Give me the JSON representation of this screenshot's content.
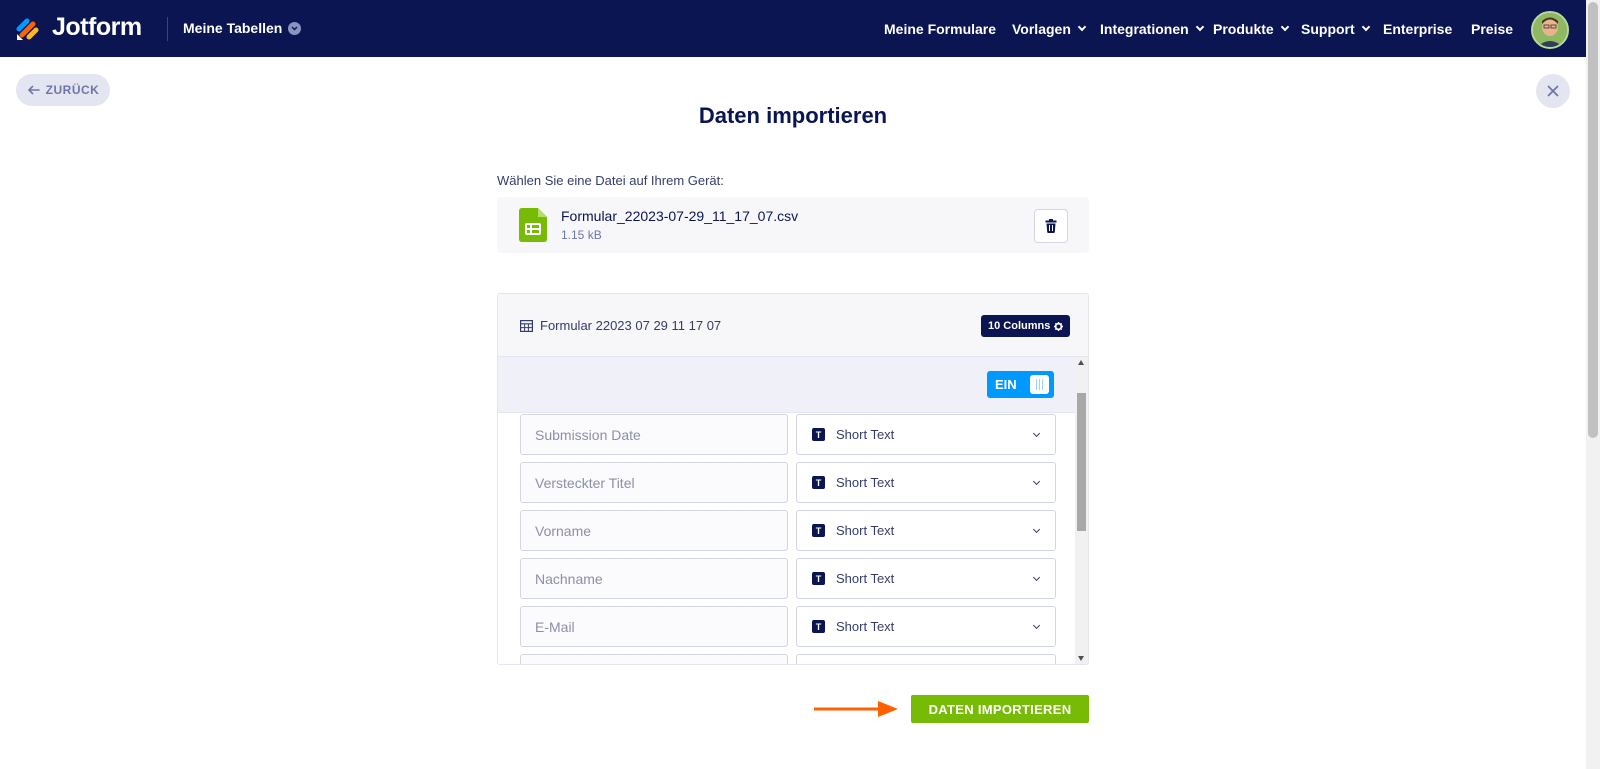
{
  "navbar": {
    "brand": "Jotform",
    "workspace": "Meine Tabellen",
    "links": [
      {
        "label": "Meine Formulare",
        "dropdown": false
      },
      {
        "label": "Vorlagen",
        "dropdown": true
      },
      {
        "label": "Integrationen",
        "dropdown": true
      },
      {
        "label": "Produkte",
        "dropdown": true
      },
      {
        "label": "Support",
        "dropdown": true
      },
      {
        "label": "Enterprise",
        "dropdown": false
      },
      {
        "label": "Preise",
        "dropdown": false
      }
    ]
  },
  "page": {
    "back_label": "ZURÜCK",
    "title": "Daten importieren",
    "choose_label": "Wählen Sie eine Datei auf Ihrem Gerät:"
  },
  "file": {
    "name": "Formular_22023-07-29_11_17_07.csv",
    "size": "1.15 kB"
  },
  "table": {
    "title": "Formular 22023 07 29 11 17 07",
    "columns_badge": "10 Columns",
    "toggle_label": "EIN",
    "rows": [
      {
        "name": "Submission Date",
        "type": "Short Text"
      },
      {
        "name": "Versteckter Titel",
        "type": "Short Text"
      },
      {
        "name": "Vorname",
        "type": "Short Text"
      },
      {
        "name": "Nachname",
        "type": "Short Text"
      },
      {
        "name": "E-Mail",
        "type": "Short Text"
      }
    ]
  },
  "actions": {
    "import_label": "DATEN IMPORTIEREN"
  },
  "colors": {
    "nav_bg": "#0a1551",
    "accent_green": "#78bb07",
    "toggle_blue": "#0099ff",
    "arrow_orange": "#ff6100"
  }
}
